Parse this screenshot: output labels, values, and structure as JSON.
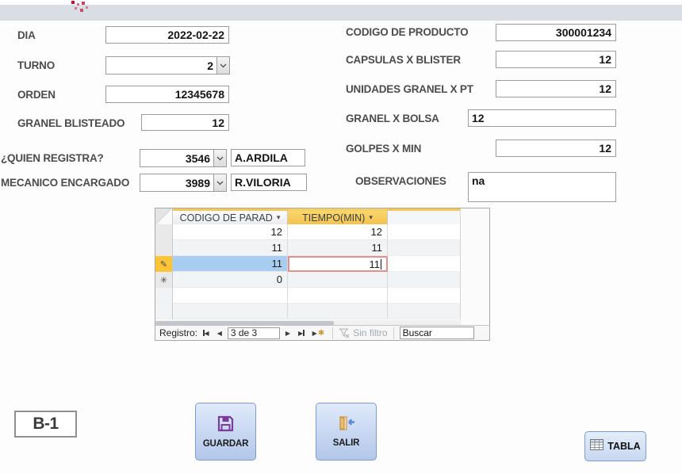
{
  "form": {
    "dia": {
      "label": "DIA",
      "value": "2022-02-22"
    },
    "turno": {
      "label": "TURNO",
      "value": "2"
    },
    "orden": {
      "label": "ORDEN",
      "value": "12345678"
    },
    "granel_blisteado": {
      "label": "GRANEL BLISTEADO",
      "value": "12"
    },
    "quien_registra": {
      "label": "¿QUIEN REGISTRA?",
      "code": "3546",
      "name": "A.ARDILA"
    },
    "mecanico_encargado": {
      "label": "MECANICO ENCARGADO",
      "code": "3989",
      "name": "R.VILORIA"
    },
    "codigo_producto": {
      "label": "CODIGO DE PRODUCTO",
      "value": "300001234"
    },
    "capsulas_blister": {
      "label": "CAPSULAS X BLISTER",
      "value": "12"
    },
    "unidades_granel": {
      "label": "UNIDADES GRANEL X PT",
      "value": "12"
    },
    "granel_bolsa": {
      "label": "GRANEL X BOLSA",
      "value": "12"
    },
    "golpes_min": {
      "label": "GOLPES X MIN",
      "value": "12"
    },
    "observaciones": {
      "label": "OBSERVACIONES",
      "value": "na"
    }
  },
  "datasheet": {
    "columns": [
      {
        "label": "CODIGO DE PARAD"
      },
      {
        "label": "TIEMPO(MIN)"
      }
    ],
    "rows": [
      [
        "12",
        "12"
      ],
      [
        "11",
        "11"
      ],
      [
        "11",
        "11"
      ],
      [
        "0",
        ""
      ]
    ],
    "selected_row": "3",
    "navigator": {
      "record_label": "Registro:",
      "position": "3 de 3",
      "filter_label": "Sin filtro",
      "search_text": "Buscar"
    }
  },
  "footer": {
    "badge": "B-1",
    "guardar": "GUARDAR",
    "salir": "SALIR",
    "tabla": "TABLA"
  },
  "colors": {
    "top_band": "#d9dee4",
    "logo_red": "#c8102e",
    "header_amber": "#f2c24e",
    "selection_blue": "#a9cdf1",
    "selector_amber": "#fcc436",
    "current_cell_border": "#e0918e",
    "button_blue": "#b3c7ea",
    "button_border": "#7d9cc9"
  }
}
